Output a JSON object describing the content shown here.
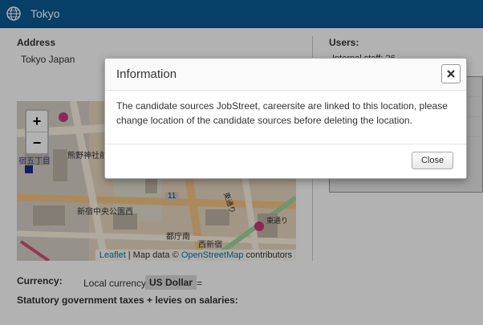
{
  "window": {
    "title": "Tokyo",
    "icon": "globe-icon"
  },
  "location": {
    "address_label": "Address",
    "address_value": "Tokyo Japan",
    "users_label": "Users:",
    "users_partial": "Internal staff: 26"
  },
  "map": {
    "zoom_in": "+",
    "zoom_out": "−",
    "attribution_prefix": "Leaflet",
    "attribution_mid": " | Map data © ",
    "attribution_link": "OpenStreetMap",
    "attribution_suffix": " contributors",
    "labels": [
      "熊野神社前",
      "宿五丁目",
      "新宿中央公園西",
      "都庁南",
      "西新宿",
      "東通り",
      "東通り",
      "11"
    ]
  },
  "currency": {
    "label": "Currency:",
    "local_label": "Local currency",
    "value": "US Dollar",
    "equals": "="
  },
  "taxes": {
    "label": "Statutory government taxes + levies on salaries:"
  },
  "modal": {
    "title": "Information",
    "message": "The candidate sources JobStreet, careersite are linked to this location, please change location of the candidate sources before deleting the location.",
    "close_label": "Close"
  }
}
